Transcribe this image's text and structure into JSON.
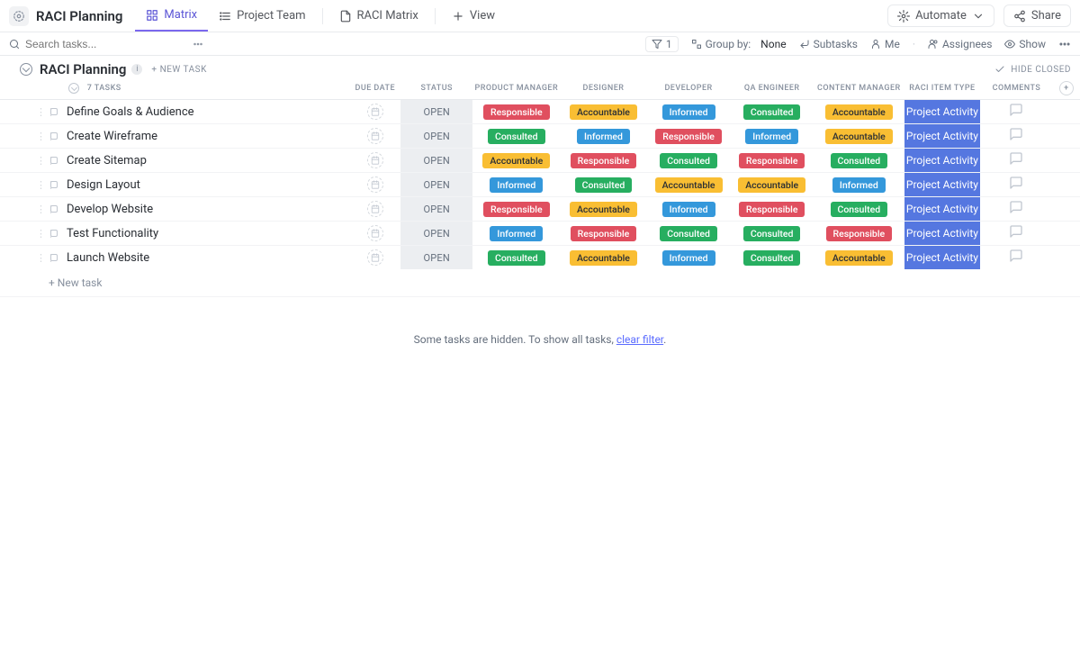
{
  "app": {
    "title": "RACI Planning"
  },
  "tabs": {
    "matrix": "Matrix",
    "team": "Project Team",
    "raci_matrix": "RACI Matrix",
    "view": "View"
  },
  "topbar": {
    "automate": "Automate",
    "share": "Share"
  },
  "toolbar": {
    "search_placeholder": "Search tasks...",
    "filter_count": "1",
    "groupby_label": "Group by:",
    "groupby_value": "None",
    "subtasks": "Subtasks",
    "me": "Me",
    "assignees": "Assignees",
    "show": "Show"
  },
  "section": {
    "title": "RACI Planning",
    "new_task": "+ NEW TASK",
    "hide_closed": "HIDE CLOSED",
    "task_count": "7 TASKS"
  },
  "columns": {
    "due_date": "DUE DATE",
    "status": "STATUS",
    "product_manager": "PRODUCT MANAGER",
    "designer": "DESIGNER",
    "developer": "DEVELOPER",
    "qa_engineer": "QA ENGINEER",
    "content_manager": "CONTENT MANAGER",
    "raci_item_type": "RACI ITEM TYPE",
    "comments": "COMMENTS"
  },
  "status_label": "OPEN",
  "type_label": "Project Activity",
  "raci": {
    "responsible": "Responsible",
    "accountable": "Accountable",
    "consulted": "Consulted",
    "informed": "Informed"
  },
  "tasks": [
    {
      "name": "Define Goals & Audience",
      "cells": [
        "responsible",
        "accountable",
        "informed",
        "consulted",
        "accountable"
      ]
    },
    {
      "name": "Create Wireframe",
      "cells": [
        "consulted",
        "informed",
        "responsible",
        "informed",
        "accountable"
      ]
    },
    {
      "name": "Create Sitemap",
      "cells": [
        "accountable",
        "responsible",
        "consulted",
        "responsible",
        "consulted"
      ]
    },
    {
      "name": "Design Layout",
      "cells": [
        "informed",
        "consulted",
        "accountable",
        "accountable",
        "informed"
      ]
    },
    {
      "name": "Develop Website",
      "cells": [
        "responsible",
        "accountable",
        "informed",
        "responsible",
        "consulted"
      ]
    },
    {
      "name": "Test Functionality",
      "cells": [
        "informed",
        "responsible",
        "consulted",
        "consulted",
        "responsible"
      ]
    },
    {
      "name": "Launch Website",
      "cells": [
        "consulted",
        "accountable",
        "informed",
        "consulted",
        "accountable"
      ]
    }
  ],
  "footer": {
    "new_task": "+ New task",
    "hidden_prefix": "Some tasks are hidden. To show all tasks, ",
    "hidden_link": "clear filter",
    "hidden_suffix": "."
  }
}
